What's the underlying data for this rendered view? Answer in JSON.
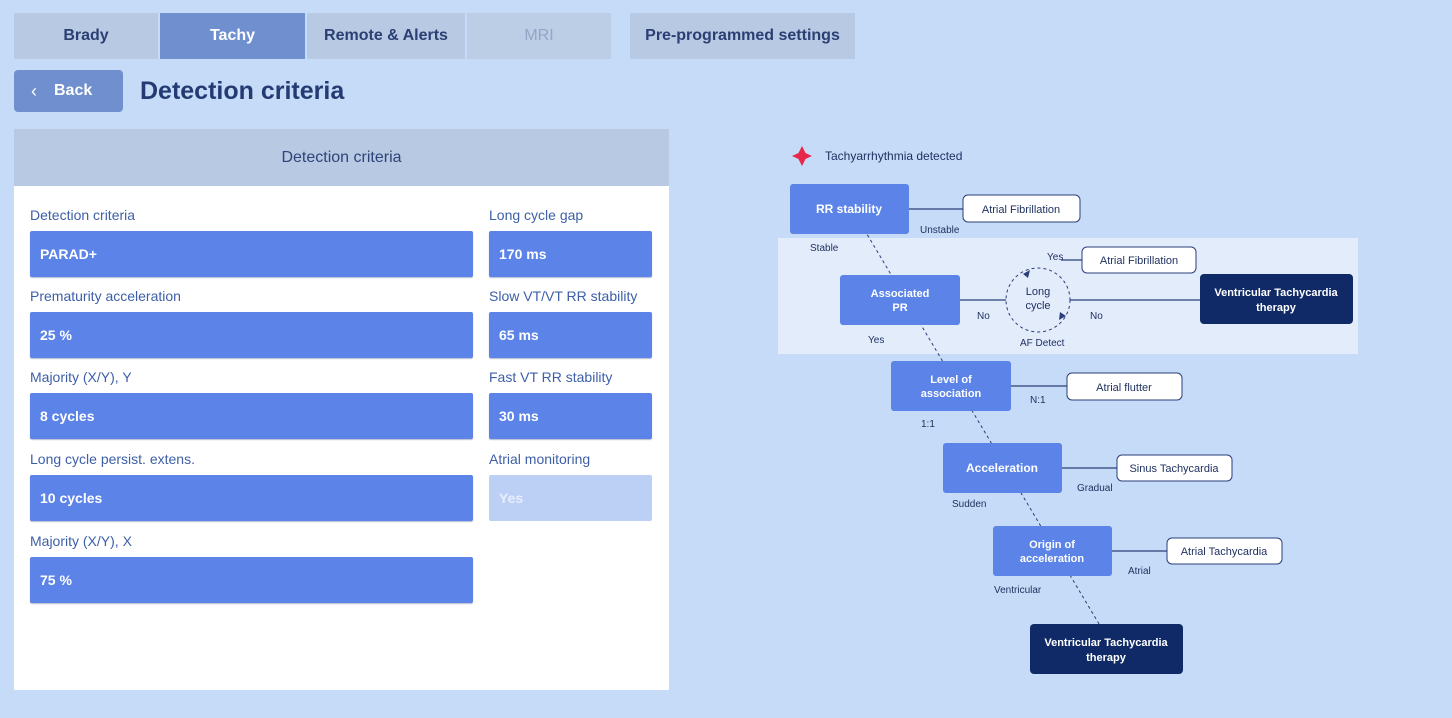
{
  "tabs": [
    {
      "label": "Brady",
      "state": "normal"
    },
    {
      "label": "Tachy",
      "state": "active"
    },
    {
      "label": "Remote & Alerts",
      "state": "normal"
    },
    {
      "label": "MRI",
      "state": "disabled"
    },
    {
      "label": "Pre-programmed settings",
      "state": "normal"
    }
  ],
  "header": {
    "back_label": "Back",
    "title": "Detection criteria"
  },
  "panel": {
    "header": "Detection criteria",
    "left_fields": [
      {
        "label": "Detection criteria",
        "value": "PARAD+"
      },
      {
        "label": "Prematurity acceleration",
        "value": "25  %"
      },
      {
        "label": "Majority (X/Y), Y",
        "value": "8  cycles"
      },
      {
        "label": "Long cycle persist. extens.",
        "value": "10  cycles"
      },
      {
        "label": "Majority (X/Y), X",
        "value": "75  %"
      }
    ],
    "right_fields": [
      {
        "label": "Long cycle gap",
        "value": "170  ms",
        "disabled": false
      },
      {
        "label": "Slow VT/VT RR stability",
        "value": "65  ms",
        "disabled": false
      },
      {
        "label": "Fast VT RR stability",
        "value": "30  ms",
        "disabled": false
      },
      {
        "label": "Atrial monitoring",
        "value": "Yes",
        "disabled": true
      }
    ]
  },
  "flowchart": {
    "start_label": "Tachyarrhythmia detected",
    "nodes": {
      "rr_stability": "RR stability",
      "associated_pr": [
        "Associated",
        "PR"
      ],
      "long_cycle": [
        "Long",
        "cycle"
      ],
      "level_of_association": [
        "Level of",
        "association"
      ],
      "acceleration": "Acceleration",
      "origin_of_acceleration": [
        "Origin of",
        "acceleration"
      ],
      "vt_therapy_1": [
        "Ventricular Tachycardia",
        "therapy"
      ],
      "vt_therapy_2": [
        "Ventricular Tachycardia",
        "therapy"
      ]
    },
    "outcomes": {
      "atrial_fibrillation_1": "Atrial Fibrillation",
      "atrial_fibrillation_2": "Atrial Fibrillation",
      "atrial_flutter": "Atrial flutter",
      "sinus_tachycardia": "Sinus Tachycardia",
      "atrial_tachycardia": "Atrial Tachycardia"
    },
    "edge_labels": {
      "unstable": "Unstable",
      "stable": "Stable",
      "yes_top": "Yes",
      "no_left": "No",
      "no_right": "No",
      "yes_bottom": "Yes",
      "af_detect": "AF Detect",
      "n1": "N:1",
      "one_one": "1:1",
      "gradual": "Gradual",
      "sudden": "Sudden",
      "atrial": "Atrial",
      "ventricular": "Ventricular"
    },
    "colors": {
      "node": "#5b83e8",
      "therapy": "#0f2a66",
      "highlight_band": "#e3ecfb",
      "star": "#e8264a"
    }
  }
}
